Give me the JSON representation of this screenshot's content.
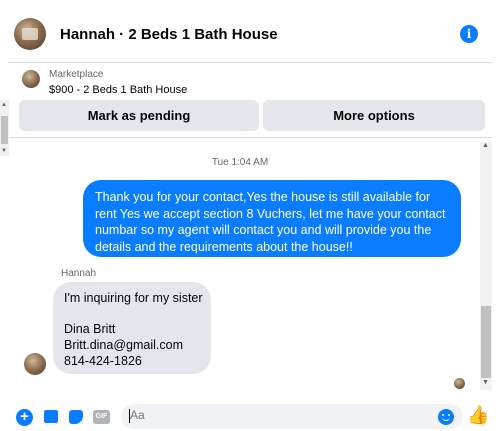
{
  "header": {
    "title": "Hannah · 2 Beds 1 Bath House",
    "info_icon": "info-icon"
  },
  "marketplace": {
    "source": "Marketplace",
    "listing": "$900 - 2 Beds 1 Bath House",
    "buttons": {
      "mark_pending": "Mark as pending",
      "more_options": "More options"
    }
  },
  "conversation": {
    "timestamp": "Tue 1:04 AM",
    "outgoing_message": "Thank you for your contact,Yes the house is still available for rent Yes we accept section 8 Vuchers, let me have your contact numbar so my agent will contact you and will provide you the details and the requirements about the house!!",
    "incoming": {
      "sender": "Hannah",
      "lines": [
        "I'm inquiring for my sister",
        "Dina Britt",
        "Britt.dina@gmail.com",
        "814-424-1826"
      ]
    }
  },
  "composer": {
    "placeholder": "Aa",
    "gif_label": "GIF",
    "plus_label": "+"
  },
  "colors": {
    "accent": "#0a7cff",
    "bubble_in": "#e4e6eb",
    "button_bg": "#e4e6eb",
    "muted_text": "#65676b"
  }
}
